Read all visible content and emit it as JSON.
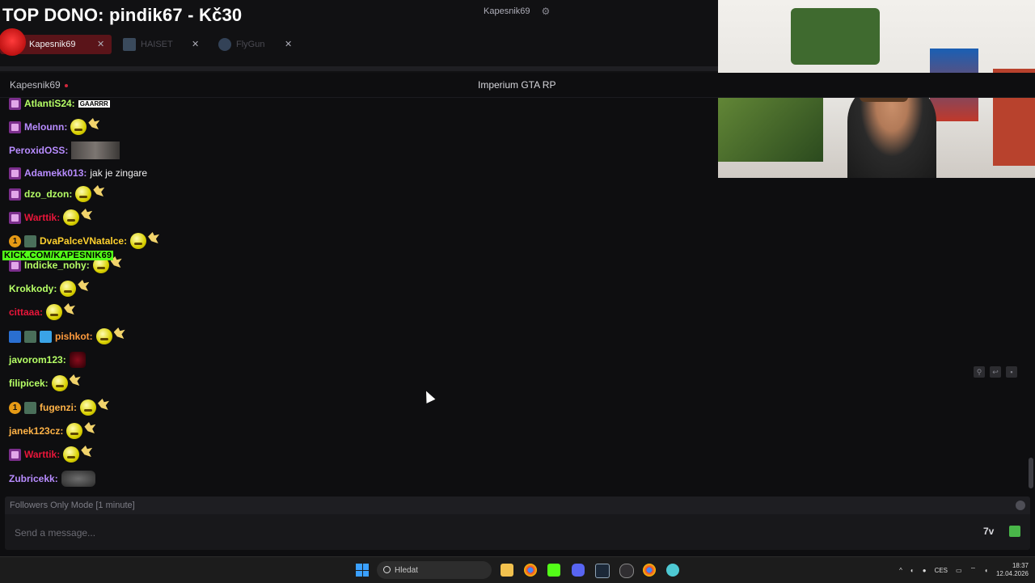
{
  "overlay": {
    "title": "TOP DONO: pindik67 - Kč30"
  },
  "header": {
    "user_chip": "Kapesnik69",
    "gear_icon": "gear-icon",
    "tabs": [
      {
        "label": "Kapesnik69",
        "active": true
      },
      {
        "label": "HAISET",
        "active": false
      },
      {
        "label": "FlyGun",
        "active": false
      }
    ]
  },
  "stream": {
    "channel": "Kapesnik69",
    "game": "Imperium GTA RP"
  },
  "kick_banner": "KICK.COM/KAPESNIK69",
  "chat": {
    "messages": [
      {
        "user": "AtlantiS24:",
        "color": "#b6ff66",
        "text": "GAARRR"
      },
      {
        "user": "Melounn:",
        "color": "#b88cff",
        "text": ""
      },
      {
        "user": "PeroxidOSS:",
        "color": "#b88cff",
        "text": ""
      },
      {
        "user": "Adamekk013:",
        "color": "#b88cff",
        "text": "jak je zingare"
      },
      {
        "user": "dzo_dzon:",
        "color": "#b6ff66",
        "text": ""
      },
      {
        "user": "Warttik:",
        "color": "#e8163a",
        "text": ""
      },
      {
        "user": "DvaPalceVNatalce:",
        "color": "#ffd12e",
        "text": ""
      },
      {
        "user": "Indicke_nohy:",
        "color": "#b6ff66",
        "text": ""
      },
      {
        "user": "Krokkody:",
        "color": "#b6ff66",
        "text": ""
      },
      {
        "user": "cittaaa:",
        "color": "#e8163a",
        "text": ""
      },
      {
        "user": "pishkot:",
        "color": "#ff9b3d",
        "text": ""
      },
      {
        "user": "javorom123:",
        "color": "#b6ff66",
        "text": ""
      },
      {
        "user": "filipicek:",
        "color": "#b6ff66",
        "text": ""
      },
      {
        "user": "fugenzi:",
        "color": "#ffb347",
        "text": ""
      },
      {
        "user": "janek123cz:",
        "color": "#ffb347",
        "text": ""
      },
      {
        "user": "Warttik:",
        "color": "#e8163a",
        "text": ""
      },
      {
        "user": "Zubricekk:",
        "color": "#b88cff",
        "text": ""
      }
    ]
  },
  "footer": {
    "followers_mode": "Followers Only Mode [1 minute]",
    "message_placeholder": "Send a message...",
    "seventv_label": "7v"
  },
  "taskbar": {
    "search_placeholder": "Hledat",
    "lang": "CES",
    "time": "18:37",
    "date": "12.04.2026"
  }
}
